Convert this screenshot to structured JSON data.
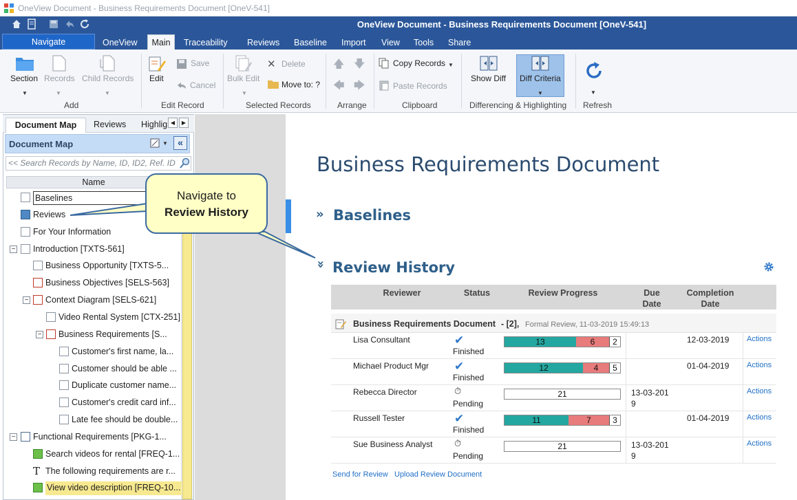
{
  "window": {
    "title": "OneView Document - Business Requirements Document [OneV-541]"
  },
  "header": {
    "title": "OneView Document - Business Requirements Document [OneV-541]"
  },
  "menu": {
    "navigate": "Navigate",
    "tabs": [
      "OneView",
      "Main",
      "Traceability",
      "Reviews",
      "Baseline",
      "Import",
      "View",
      "Tools",
      "Share"
    ],
    "active": "Main"
  },
  "ribbon": {
    "section": "Section",
    "records": "Records",
    "child_records": "Child Records",
    "group_add": "Add",
    "edit": "Edit",
    "save": "Save",
    "cancel": "Cancel",
    "group_edit": "Edit Record",
    "bulk_edit": "Bulk Edit",
    "delete": "Delete",
    "move_to": "Move to: ?",
    "group_selected": "Selected Records",
    "group_arrange": "Arrange",
    "copy_records": "Copy Records",
    "paste_records": "Paste Records",
    "group_clipboard": "Clipboard",
    "show_diff": "Show Diff",
    "diff_criteria": "Diff Criteria",
    "group_diff": "Differencing & Highlighting",
    "refresh": "Refresh"
  },
  "left_panel": {
    "tabs": [
      "Document Map",
      "Reviews",
      "Highlig"
    ],
    "header": "Document Map",
    "search_placeholder": "<< Search Records by Name, ID, ID2, Ref. ID",
    "column": "Name",
    "tree": [
      {
        "label": "Baselines",
        "indent": 0,
        "icon": "baseline-icon"
      },
      {
        "label": "Reviews",
        "indent": 0,
        "icon": "reviews-icon"
      },
      {
        "label": "For Your Information",
        "indent": 0,
        "icon": "fyi-icon"
      },
      {
        "label": "Introduction [TXTS-561]",
        "indent": 0,
        "icon": "section-icon",
        "expander": "−"
      },
      {
        "label": "Business Opportunity [TXTS-5...",
        "indent": 1,
        "icon": "text-record-icon"
      },
      {
        "label": "Business Objectives [SELS-563]",
        "indent": 1,
        "icon": "checklist-icon"
      },
      {
        "label": "Context Diagram [SELS-621]",
        "indent": 1,
        "icon": "checklist-icon",
        "expander": "−"
      },
      {
        "label": "Video Rental System [CTX-251]",
        "indent": 2,
        "icon": "actor-icon"
      },
      {
        "label": "Business Requirements [S...",
        "indent": 2,
        "icon": "checklist-icon",
        "expander": "−"
      },
      {
        "label": "Customer's first name, la...",
        "indent": 3,
        "icon": "page-icon"
      },
      {
        "label": "Customer should be able ...",
        "indent": 3,
        "icon": "page-icon"
      },
      {
        "label": "Duplicate customer name...",
        "indent": 3,
        "icon": "page-icon"
      },
      {
        "label": "Customer's credit card inf...",
        "indent": 3,
        "icon": "page-icon"
      },
      {
        "label": "Late fee should be double...",
        "indent": 3,
        "icon": "page-icon"
      },
      {
        "label": "Functional Requirements [PKG-1...",
        "indent": 0,
        "icon": "folder-icon",
        "expander": "−"
      },
      {
        "label": "Search videos for rental [FREQ-1...",
        "indent": 1,
        "icon": "green-page-icon"
      },
      {
        "label": "The following requirements are r...",
        "indent": 1,
        "icon": "text-t-icon"
      },
      {
        "label": "View video description [FREQ-10...",
        "indent": 1,
        "icon": "green-page-icon",
        "selected": true
      }
    ]
  },
  "callout": {
    "line1": "Navigate to",
    "line2": "Review History"
  },
  "document": {
    "title": "Business Requirements Document",
    "baselines": "Baselines",
    "review_history": "Review History",
    "table": {
      "headers": [
        "Reviewer",
        "Status",
        "Review Progress",
        "Due\nDate",
        "Completion\nDate"
      ],
      "group": {
        "name": "Business Requirements Document",
        "count": " - [2],",
        "meta": "Formal Review, 11-03-2019 15:49:13"
      },
      "rows": [
        {
          "reviewer": "Lisa Consultant",
          "status": "Finished",
          "done": true,
          "progress": [
            13,
            6,
            2
          ],
          "due": "",
          "completion": "12-03-2019",
          "action": "Actions"
        },
        {
          "reviewer": "Michael Product Mgr",
          "status": "Finished",
          "done": true,
          "progress": [
            12,
            4,
            5
          ],
          "due": "",
          "completion": "01-04-2019",
          "action": "Actions"
        },
        {
          "reviewer": "Rebecca Director",
          "status": "Pending",
          "done": false,
          "progress": [
            0,
            0,
            21
          ],
          "due": "13-03-201\n9",
          "completion": "",
          "action": "Actions"
        },
        {
          "reviewer": "Russell Tester",
          "status": "Finished",
          "done": true,
          "progress": [
            11,
            7,
            3
          ],
          "due": "",
          "completion": "01-04-2019",
          "action": "Actions"
        },
        {
          "reviewer": "Sue Business Analyst",
          "status": "Pending",
          "done": false,
          "progress": [
            0,
            0,
            21
          ],
          "due": "13-03-201\n9",
          "completion": "",
          "action": "Actions"
        }
      ]
    },
    "send_for_review": "Send for Review",
    "upload_review": "Upload Review Document"
  },
  "colors": {
    "header": "#2b579a",
    "approved": "#23a7a0",
    "rejected": "#e87b7b",
    "link": "#1f6fc6"
  }
}
